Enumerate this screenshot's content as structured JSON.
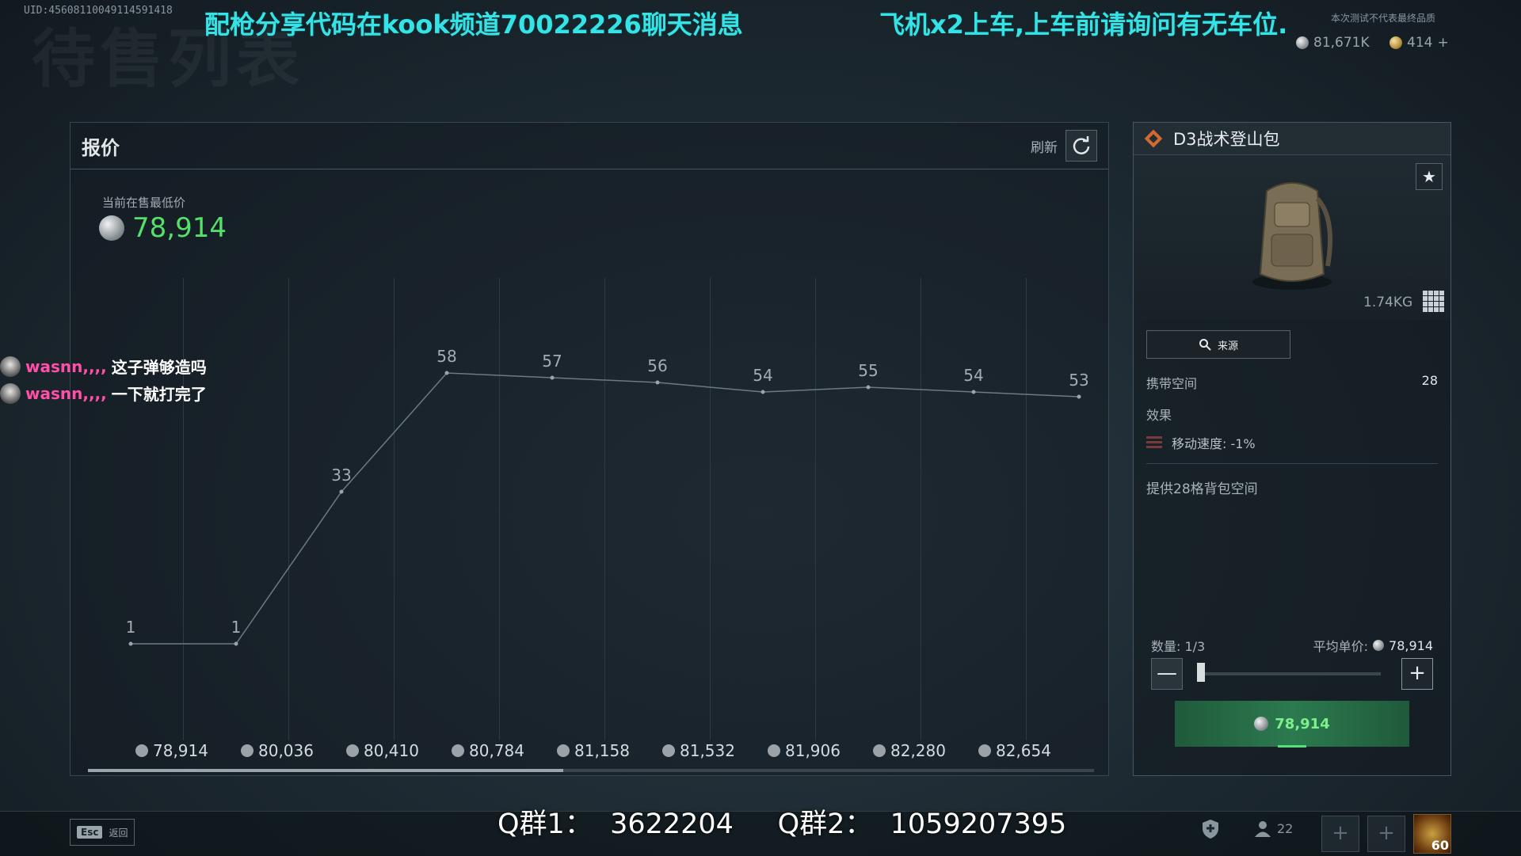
{
  "background_title": "待售列表",
  "uid": "UID:456081100491145914​18",
  "overlay": {
    "left": "配枪分享代码在kook频道70022226聊天消息",
    "right": "飞机x2上车,上车前请询问有无车位."
  },
  "notice": "本次测试不代表最终品质",
  "currency": {
    "silver": "81,671K",
    "gold": "414",
    "plus": "+"
  },
  "quote": {
    "title": "报价",
    "refresh_label": "刷新",
    "lowest_label": "当前在售最低价",
    "lowest_price": "78,914"
  },
  "chart_data": {
    "type": "line",
    "x": [
      "78,914",
      "80,036",
      "80,410",
      "80,784",
      "81,158",
      "81,532",
      "81,906",
      "82,280",
      "82,654"
    ],
    "values": [
      1,
      1,
      33,
      58,
      57,
      56,
      54,
      55,
      54,
      53
    ],
    "grid": true,
    "xlabel": "",
    "ylabel": ""
  },
  "item": {
    "name": "D3战术登山包",
    "weight": "1.74KG",
    "source_label": "来源",
    "capacity_label": "携带空间",
    "capacity_value": "28",
    "effect_label": "效果",
    "effect_text": "移动速度: -1%",
    "description": "提供28格背包空间",
    "quantity_label": "数量: 1/3",
    "avg_price_label": "平均单价:",
    "avg_price": "78,914",
    "buy_price": "78,914",
    "minus": "—",
    "plus": "+",
    "star": "★"
  },
  "chat": [
    {
      "user": "wasnn,,,,",
      "message": "这子弹够造吗"
    },
    {
      "user": "wasnn,,,,",
      "message": "一下就打完了"
    }
  ],
  "bottom": {
    "esc_key": "Esc",
    "esc_label": "返回",
    "qq_text": "Q群1：  3622204     Q群2：  1059207395",
    "friends": "22",
    "level": "60",
    "slot_plus": "+"
  }
}
